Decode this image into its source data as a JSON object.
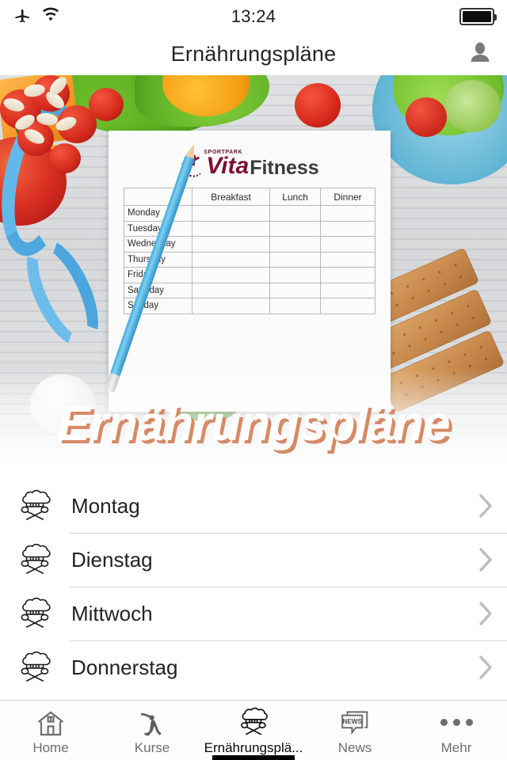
{
  "status_bar": {
    "airplane_icon": "airplane-icon",
    "wifi_icon": "wifi-icon",
    "time": "13:24",
    "battery_icon": "battery-full-icon"
  },
  "nav_bar": {
    "title": "Ernährungspläne",
    "profile_icon": "person-icon"
  },
  "hero": {
    "overlay_title": "Ernährungspläne",
    "overlay_text_color": "#ffffff",
    "overlay_shadow_color": "#d68a66",
    "paper": {
      "logo": {
        "sportpark": "SPORTPARK",
        "vita": "Vita",
        "fitness": "Fitness",
        "brand_color": "#7c0f33"
      },
      "columns": [
        "",
        "Breakfast",
        "Lunch",
        "Dinner"
      ],
      "rows": [
        "Monday",
        "Tuesday",
        "Wednesday",
        "Thursday",
        "Friday",
        "Saturday",
        "Sunday"
      ]
    }
  },
  "list": {
    "items": [
      {
        "label": "Montag",
        "icon": "chef-hat-icon",
        "chevron": "chevron-right-icon"
      },
      {
        "label": "Dienstag",
        "icon": "chef-hat-icon",
        "chevron": "chevron-right-icon"
      },
      {
        "label": "Mittwoch",
        "icon": "chef-hat-icon",
        "chevron": "chevron-right-icon"
      },
      {
        "label": "Donnerstag",
        "icon": "chef-hat-icon",
        "chevron": "chevron-right-icon"
      }
    ]
  },
  "tab_bar": {
    "active_index": 2,
    "active_color": "#0a0a0a",
    "inactive_color": "#6e6e6e",
    "items": [
      {
        "label": "Home",
        "icon": "house-icon"
      },
      {
        "label": "Kurse",
        "icon": "stretching-person-icon"
      },
      {
        "label": "Ernährungsplä...",
        "icon": "chef-hat-icon"
      },
      {
        "label": "News",
        "icon": "news-icon",
        "icon_text": "NEWS"
      },
      {
        "label": "Mehr",
        "icon": "ellipsis-icon"
      }
    ]
  }
}
